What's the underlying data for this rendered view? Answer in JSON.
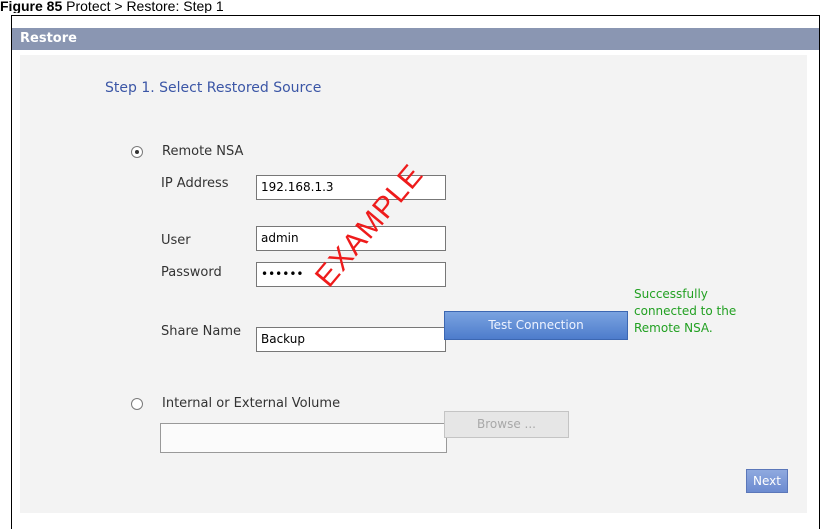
{
  "caption": {
    "figure": "Figure 85",
    "text": "Protect > Restore: Step 1"
  },
  "window": {
    "title": "Restore"
  },
  "step": {
    "title": "Step 1. Select Restored Source"
  },
  "options": {
    "remote_label": "Remote NSA",
    "internal_label": "Internal or External Volume"
  },
  "fields": {
    "ip_label": "IP Address",
    "ip_value": "192.168.1.3",
    "user_label": "User",
    "user_value": "admin",
    "password_label": "Password",
    "password_value": "••••••",
    "share_label": "Share Name",
    "share_value": "Backup",
    "volume_value": ""
  },
  "buttons": {
    "test": "Test Connection",
    "browse": "Browse ...",
    "next": "Next"
  },
  "status": {
    "text": "Successfully connected to the Remote NSA."
  },
  "watermark": "EXAMPLE",
  "colors": {
    "titlebar": "#8a96b2",
    "status": "#22a022",
    "watermark": "#ee1b1b"
  }
}
